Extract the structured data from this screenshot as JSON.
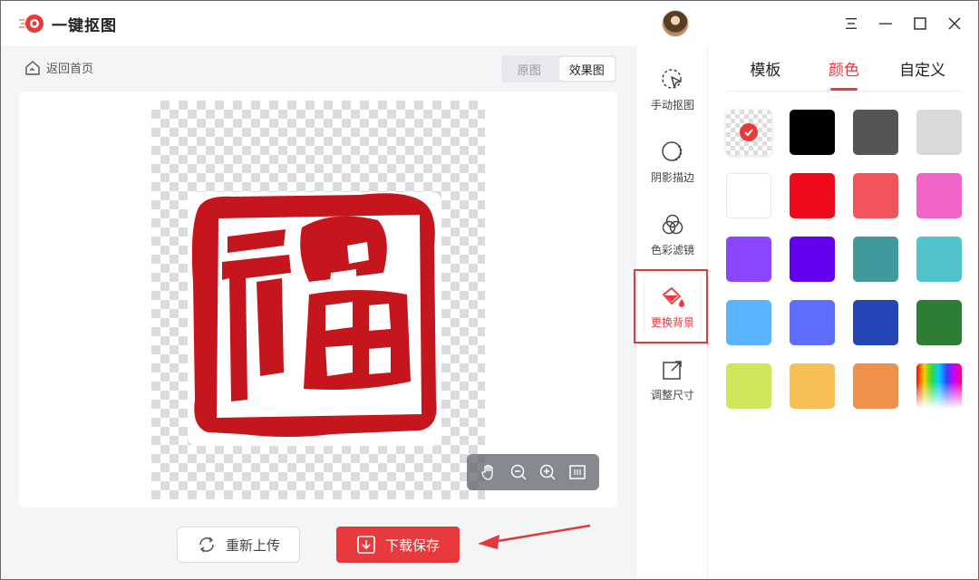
{
  "app": {
    "title": "一键抠图"
  },
  "header": {
    "avatar_icon": "user-avatar",
    "window_controls": [
      "menu-icon",
      "minimize-icon",
      "maximize-icon",
      "close-icon"
    ]
  },
  "main": {
    "back_label": "返回首页",
    "view_toggle": {
      "options": [
        "原图",
        "效果图"
      ],
      "selected": "效果图"
    },
    "zoom_tools": [
      "hand-icon",
      "zoom-out-icon",
      "zoom-in-icon",
      "fit-screen-icon"
    ],
    "reupload_label": "重新上传",
    "download_label": "下载保存"
  },
  "tools": {
    "items": [
      {
        "label": "手动抠图",
        "icon": "manual-cutout-icon"
      },
      {
        "label": "阴影描边",
        "icon": "shadow-outline-icon"
      },
      {
        "label": "色彩滤镜",
        "icon": "color-filter-icon"
      },
      {
        "label": "更换背景",
        "icon": "paint-bucket-icon"
      },
      {
        "label": "调整尺寸",
        "icon": "resize-icon"
      }
    ],
    "active": "更换背景"
  },
  "panel": {
    "tabs": [
      {
        "label": "模板"
      },
      {
        "label": "颜色"
      },
      {
        "label": "自定义"
      }
    ],
    "active_tab": "颜色",
    "swatches": [
      "transparent",
      "#000000",
      "#555555",
      "#d9d9d9",
      "#ffffff",
      "#ee0c1c",
      "#f05458",
      "#f064c8",
      "#8c46ff",
      "#6400f0",
      "#41999b",
      "#50c3cc",
      "#5ab4ff",
      "#5f6eff",
      "#2346b4",
      "#2e7d32",
      "#cde65a",
      "#f7bf55",
      "#f0914b",
      "rainbow"
    ],
    "selected_swatch": "transparent"
  },
  "colors": {
    "accent": "#e8393d",
    "stamp": "#c4161c"
  }
}
